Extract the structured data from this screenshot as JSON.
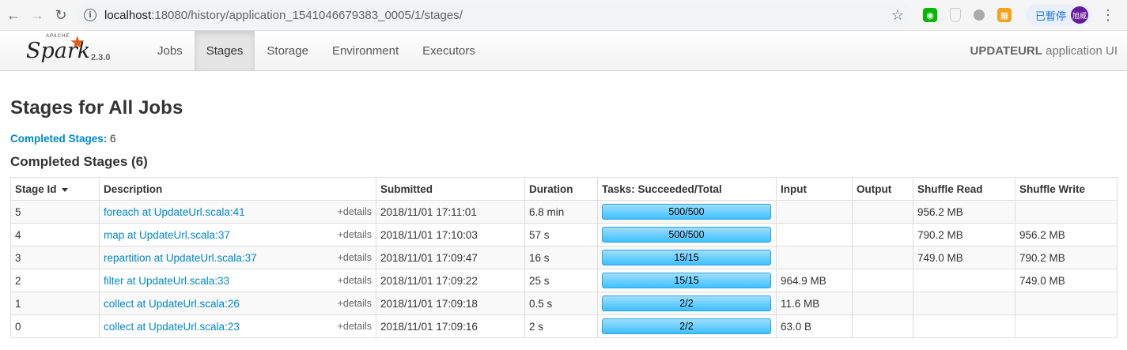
{
  "browser": {
    "url_host": "localhost",
    "url_path": ":18080/history/application_1541046679383_0005/1/stages/",
    "paused_label": "已暫停",
    "avatar_text": "旭威"
  },
  "navbar": {
    "brand_apache": "APACHE",
    "brand_spark": "Spark",
    "version": "2.3.0",
    "tabs": [
      "Jobs",
      "Stages",
      "Storage",
      "Environment",
      "Executors"
    ],
    "active_tab": "Stages",
    "app_name_bold": "UPDATEURL",
    "app_name_rest": " application UI"
  },
  "page": {
    "title": "Stages for All Jobs",
    "summary_label": "Completed Stages:",
    "summary_value": " 6",
    "section_title": "Completed Stages (6)"
  },
  "table": {
    "headers": [
      "Stage Id",
      "Description",
      "Submitted",
      "Duration",
      "Tasks: Succeeded/Total",
      "Input",
      "Output",
      "Shuffle Read",
      "Shuffle Write"
    ],
    "details_label": "+details",
    "rows": [
      {
        "id": "5",
        "desc": "foreach at UpdateUrl.scala:41",
        "submitted": "2018/11/01 17:11:01",
        "duration": "6.8 min",
        "tasks": "500/500",
        "tasks_fraction": 1.0,
        "input": "",
        "output": "",
        "shuffle_read": "956.2 MB",
        "shuffle_write": ""
      },
      {
        "id": "4",
        "desc": "map at UpdateUrl.scala:37",
        "submitted": "2018/11/01 17:10:03",
        "duration": "57 s",
        "tasks": "500/500",
        "tasks_fraction": 1.0,
        "input": "",
        "output": "",
        "shuffle_read": "790.2 MB",
        "shuffle_write": "956.2 MB"
      },
      {
        "id": "3",
        "desc": "repartition at UpdateUrl.scala:37",
        "submitted": "2018/11/01 17:09:47",
        "duration": "16 s",
        "tasks": "15/15",
        "tasks_fraction": 1.0,
        "input": "",
        "output": "",
        "shuffle_read": "749.0 MB",
        "shuffle_write": "790.2 MB"
      },
      {
        "id": "2",
        "desc": "filter at UpdateUrl.scala:33",
        "submitted": "2018/11/01 17:09:22",
        "duration": "25 s",
        "tasks": "15/15",
        "tasks_fraction": 1.0,
        "input": "964.9 MB",
        "output": "",
        "shuffle_read": "",
        "shuffle_write": "749.0 MB"
      },
      {
        "id": "1",
        "desc": "collect at UpdateUrl.scala:26",
        "submitted": "2018/11/01 17:09:18",
        "duration": "0.5 s",
        "tasks": "2/2",
        "tasks_fraction": 1.0,
        "input": "11.6 MB",
        "output": "",
        "shuffle_read": "",
        "shuffle_write": ""
      },
      {
        "id": "0",
        "desc": "collect at UpdateUrl.scala:23",
        "submitted": "2018/11/01 17:09:16",
        "duration": "2 s",
        "tasks": "2/2",
        "tasks_fraction": 1.0,
        "input": "63.0 B",
        "output": "",
        "shuffle_read": "",
        "shuffle_write": ""
      }
    ]
  },
  "colors": {
    "link": "#0088cc",
    "progress": "#3ec0ff",
    "spark_orange": "#e25a1c"
  }
}
